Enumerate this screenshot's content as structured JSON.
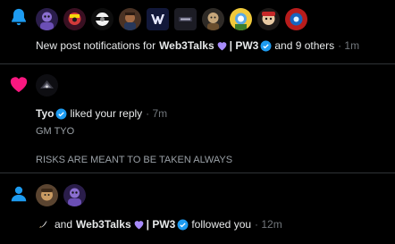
{
  "colors": {
    "background": "#000000",
    "divider": "#2f3336",
    "bell": "#1d9bf0",
    "heart": "#f91880",
    "person": "#1d9bf0",
    "verified": "#1d9bf0",
    "purple_heart": "#a78bfa"
  },
  "notifications": [
    {
      "icon": "bell-icon",
      "avatar_count": 10,
      "text_before": "New post notifications for",
      "account_name": "Web3Talks",
      "account_suffix": "| PW3",
      "text_after": "and 9 others",
      "time": "· 1m"
    },
    {
      "icon": "heart-icon",
      "avatar_count": 1,
      "user": "Tyo",
      "action": "liked your reply",
      "time": "· 7m",
      "reply_line_1": "GM TYO",
      "reply_line_2": "RISKS ARE MEANT TO BE TAKEN ALWAYS"
    },
    {
      "icon": "person-icon",
      "avatar_count": 2,
      "text_and": "and",
      "account_name": "Web3Talks",
      "account_suffix": "| PW3",
      "action": "followed you",
      "time": "· 12m"
    }
  ]
}
